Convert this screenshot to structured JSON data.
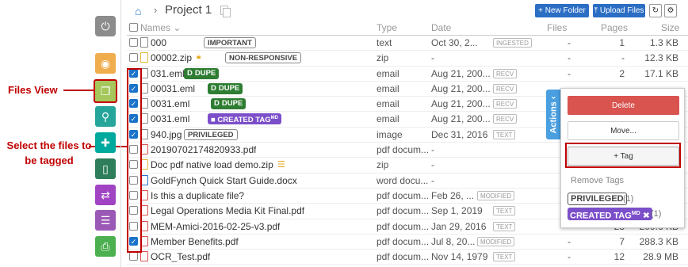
{
  "annotations": {
    "files_view": "Files View",
    "select_files": "Select the files to be tagged"
  },
  "sidebar": {
    "icons": [
      "power-icon",
      "eye-icon",
      "files-icon",
      "search-icon",
      "puzzle-icon",
      "bookmark-icon",
      "transfer-icon",
      "list-icon",
      "print-icon"
    ]
  },
  "header": {
    "project_title": "Project 1",
    "new_folder": "+ New Folder",
    "upload_files": "Upload Files"
  },
  "table": {
    "columns": {
      "names": "Names",
      "type": "Type",
      "date": "Date",
      "files": "Files",
      "pages": "Pages",
      "size": "Size"
    },
    "rows": [
      {
        "checked": false,
        "icon": "doc",
        "name": "000",
        "tag": "IMPORTANT",
        "type": "text",
        "date": "Oct 30, 2...",
        "badge": "INGESTED",
        "files": "-",
        "pages": "1",
        "size": "1.3 KB"
      },
      {
        "checked": false,
        "icon": "zip",
        "name": "00002.zip",
        "tag": "NON-RESPONSIVE",
        "type": "zip",
        "date": "-",
        "badge": "",
        "files": "-",
        "pages": "-",
        "size": "12.3 KB"
      },
      {
        "checked": true,
        "icon": "doc",
        "name": "031.eml",
        "tag": "DUPE",
        "type": "email",
        "date": "Aug 21, 200...",
        "badge": "RECV",
        "files": "-",
        "pages": "2",
        "size": "17.1 KB"
      },
      {
        "checked": true,
        "icon": "doc",
        "name": "00031.eml",
        "tag": "DUPE",
        "type": "email",
        "date": "Aug 21, 200...",
        "badge": "RECV",
        "files": "",
        "pages": "",
        "size": ""
      },
      {
        "checked": true,
        "icon": "doc",
        "name": "0031.eml",
        "tag": "DUPE",
        "type": "email",
        "date": "Aug 21, 200...",
        "badge": "RECV",
        "files": "",
        "pages": "",
        "size": ""
      },
      {
        "checked": true,
        "icon": "doc",
        "name": "0031.eml",
        "tag": "CREATED TAG",
        "type": "email",
        "date": "Aug 21, 200...",
        "badge": "RECV",
        "files": "",
        "pages": "",
        "size": ""
      },
      {
        "checked": true,
        "icon": "doc",
        "name": "940.jpg",
        "tag": "PRIVILEGED",
        "type": "image",
        "date": "Dec 31, 2016",
        "badge": "TEXT",
        "files": "",
        "pages": "",
        "size": ""
      },
      {
        "checked": false,
        "icon": "pdf",
        "name": "20190702174820933.pdf",
        "tag": "",
        "type": "pdf docum...",
        "date": "-",
        "badge": "",
        "files": "",
        "pages": "",
        "size": ""
      },
      {
        "checked": false,
        "icon": "zip",
        "name": "Doc pdf native load demo.zip",
        "tag": "",
        "type": "zip",
        "date": "-",
        "badge": "",
        "files": "",
        "pages": "",
        "size": ""
      },
      {
        "checked": false,
        "icon": "word",
        "name": "GoldFynch Quick Start Guide.docx",
        "tag": "",
        "type": "word docu...",
        "date": "-",
        "badge": "",
        "files": "",
        "pages": "",
        "size": ""
      },
      {
        "checked": false,
        "icon": "pdf",
        "name": "Is this a duplicate file?",
        "tag": "",
        "type": "pdf docum...",
        "date": "Feb 26, ...",
        "badge": "MODIFIED",
        "files": "",
        "pages": "",
        "size": ""
      },
      {
        "checked": false,
        "icon": "pdf",
        "name": "Legal Operations Media Kit Final.pdf",
        "tag": "",
        "type": "pdf docum...",
        "date": "Sep 1, 2019",
        "badge": "TEXT",
        "files": "",
        "pages": "",
        "size": ""
      },
      {
        "checked": false,
        "icon": "pdf",
        "name": "MEM-Amici-2016-02-25-v3.pdf",
        "tag": "",
        "type": "pdf docum...",
        "date": "Jan 29, 2016",
        "badge": "TEXT",
        "files": "-",
        "pages": "23",
        "size": "209.6 KB"
      },
      {
        "checked": true,
        "icon": "pdf",
        "name": "Member Benefits.pdf",
        "tag": "",
        "type": "pdf docum...",
        "date": "Jul 8, 20...",
        "badge": "MODIFIED",
        "files": "-",
        "pages": "7",
        "size": "288.3 KB"
      },
      {
        "checked": false,
        "icon": "pdf",
        "name": "OCR_Test.pdf",
        "tag": "",
        "type": "pdf docum...",
        "date": "Nov 14, 1979",
        "badge": "TEXT",
        "files": "-",
        "pages": "12",
        "size": "28.9 MB"
      }
    ]
  },
  "actions": {
    "tab_label": "Actions",
    "delete": "Delete",
    "move": "Move...",
    "tag": "+ Tag",
    "remove_tags": "Remove Tags",
    "tags": [
      {
        "label": "PRIVILEGED",
        "count": "(1)"
      },
      {
        "label": "CREATED TAG",
        "sup": "MD",
        "count": "(1)"
      }
    ]
  }
}
